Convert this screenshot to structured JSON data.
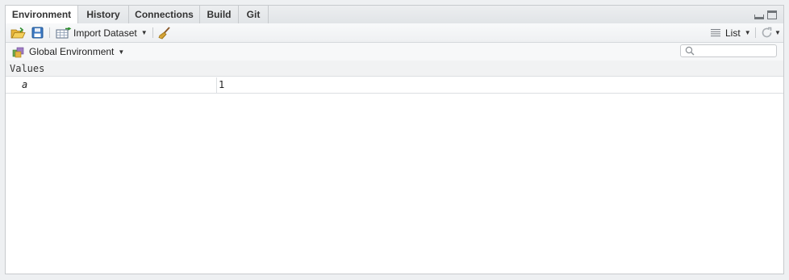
{
  "tabs": [
    {
      "label": "Environment",
      "active": true
    },
    {
      "label": "History"
    },
    {
      "label": "Connections"
    },
    {
      "label": "Build"
    },
    {
      "label": "Git"
    }
  ],
  "toolbar": {
    "import_label": "Import Dataset",
    "view_label": "List"
  },
  "env": {
    "selector_label": "Global Environment",
    "search_placeholder": ""
  },
  "section": {
    "title": "Values"
  },
  "variables": [
    {
      "name": "a",
      "value": "1"
    }
  ],
  "icons": {
    "open": "open-folder-icon",
    "save": "save-icon",
    "import": "import-dataset-icon",
    "clear": "broom-icon",
    "list": "list-icon",
    "refresh": "refresh-icon",
    "search": "search-icon",
    "env": "environment-icon"
  },
  "colors": {
    "pane_border": "#c7cacd",
    "tab_bg": "#e1e4e7",
    "active_tab_bg": "#ffffff"
  }
}
